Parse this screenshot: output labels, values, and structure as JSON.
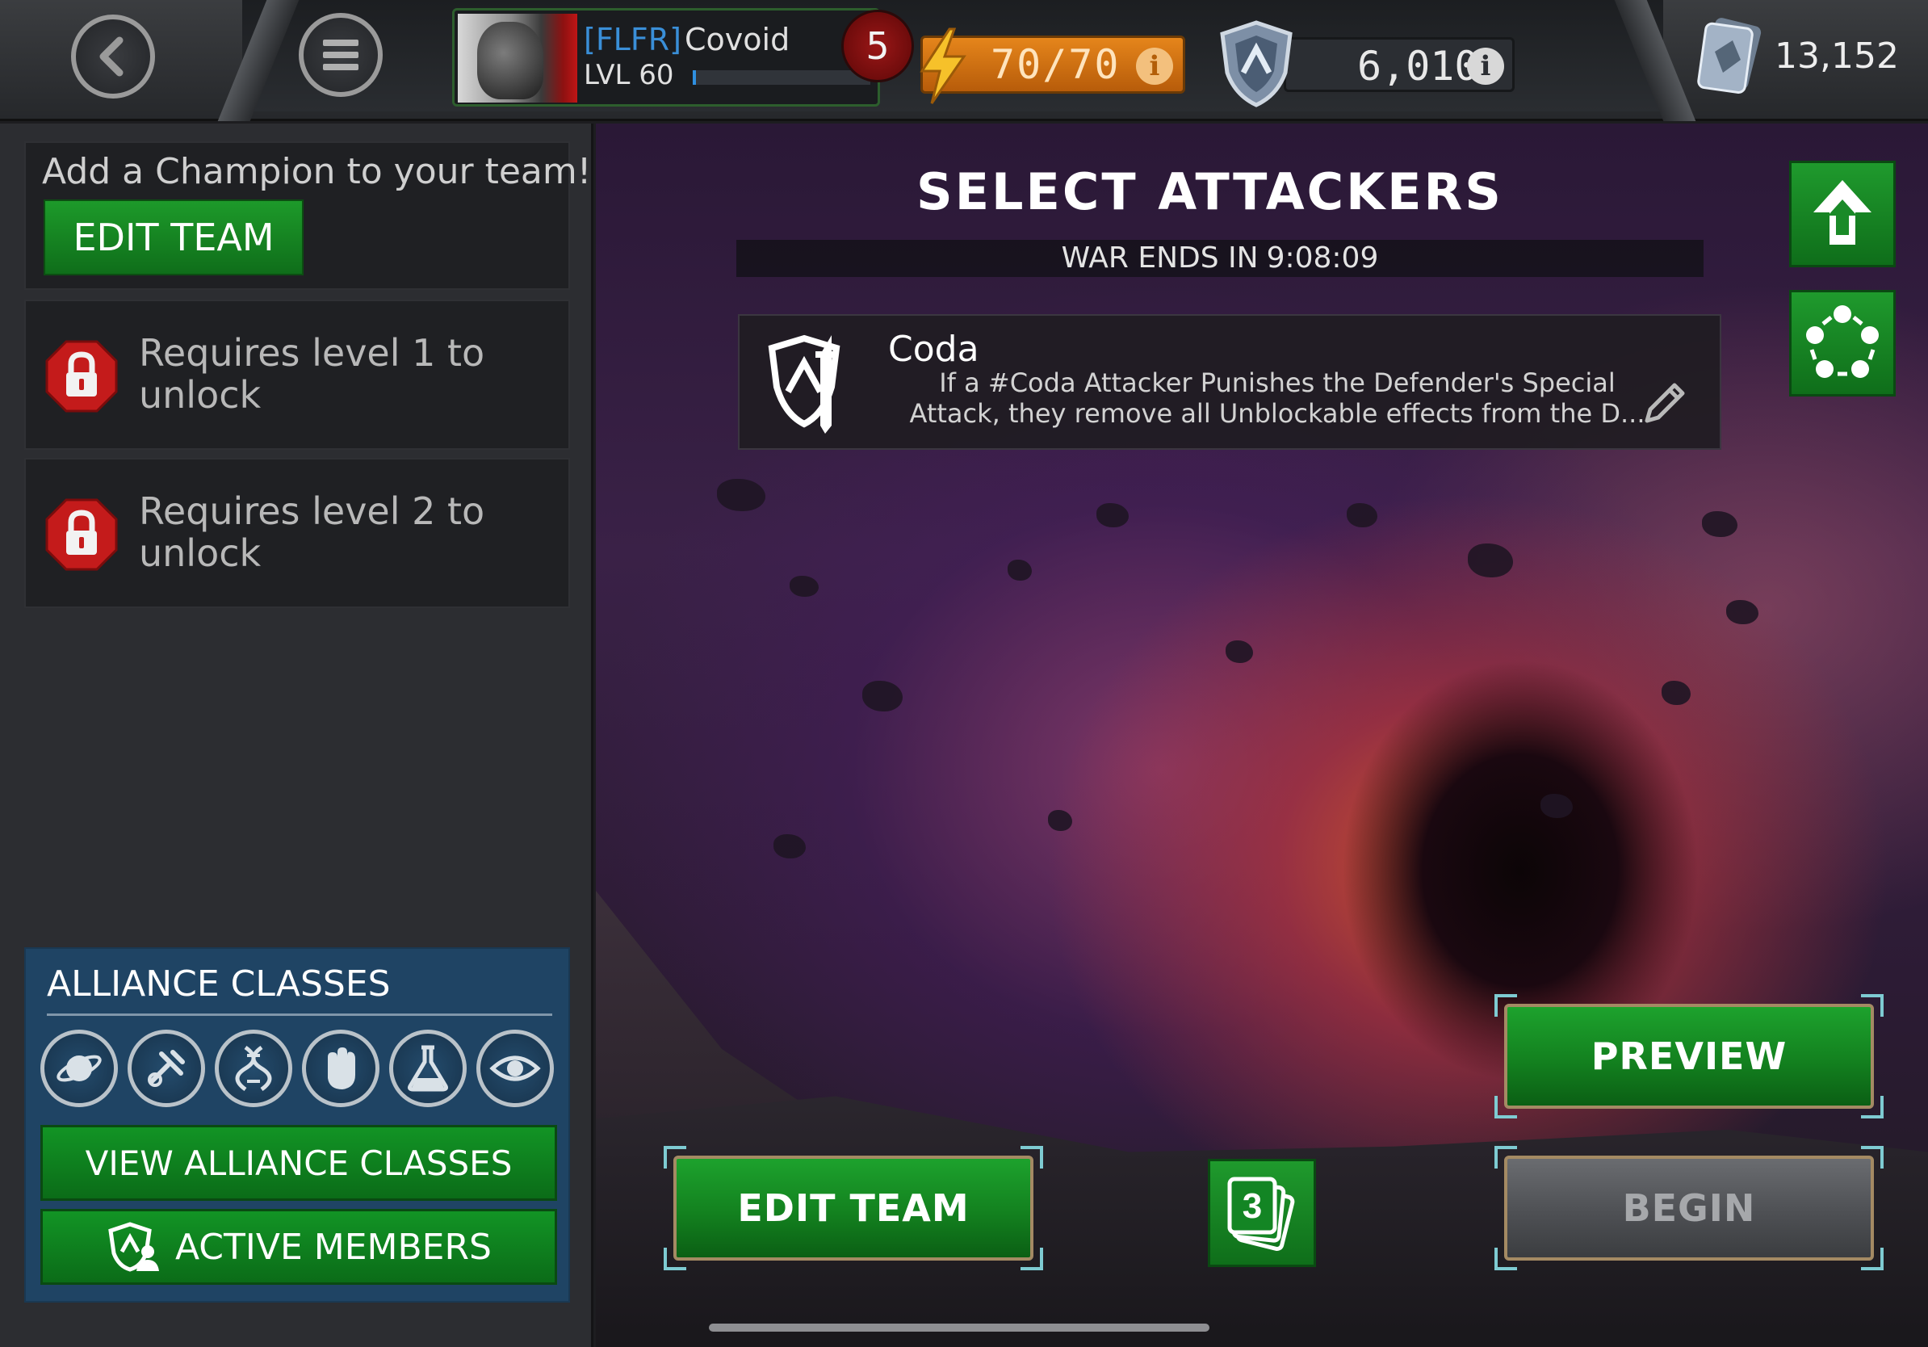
{
  "topbar": {
    "back_icon": "chevron-left-icon",
    "menu_icon": "hamburger-menu-icon",
    "profile": {
      "alliance_tag": "[FLFR]",
      "name": "Covoid",
      "level": "LVL 60",
      "xp_progress": 0.02
    },
    "notification_count": "5",
    "energy": "70/70",
    "war_rating": "6,010",
    "battlechips": "13,152",
    "colors": {
      "energy": "#e5851b",
      "accent_green": "#129425",
      "alliance_tag": "#3a8fd8"
    }
  },
  "left_panel": {
    "add_champion_text": "Add a Champion to your team!",
    "edit_team_label": "EDIT TEAM",
    "locked_slots": [
      {
        "text": "Requires level 1 to unlock",
        "icon": "lock-icon"
      },
      {
        "text": "Requires level 2 to unlock",
        "icon": "lock-icon"
      }
    ],
    "alliance_classes": {
      "title": "ALLIANCE CLASSES",
      "class_icons": [
        "cosmic-icon",
        "tech-icon",
        "mutant-icon",
        "skill-icon",
        "science-icon",
        "mystic-icon"
      ],
      "view_button": "VIEW ALLIANCE CLASSES",
      "active_members_button": "ACTIVE MEMBERS"
    }
  },
  "main": {
    "title": "SELECT ATTACKERS",
    "war_timer_label": "WAR ENDS IN",
    "war_timer_value": "9:08:09",
    "tactic": {
      "name": "Coda",
      "description": "If a #Coda Attacker Punishes the Defender's Special Attack, they remove all Unblockable effects from the D..."
    },
    "buttons": {
      "preview": "PREVIEW",
      "begin": "BEGIN",
      "edit_team": "EDIT TEAM",
      "decks_count": "3"
    }
  }
}
